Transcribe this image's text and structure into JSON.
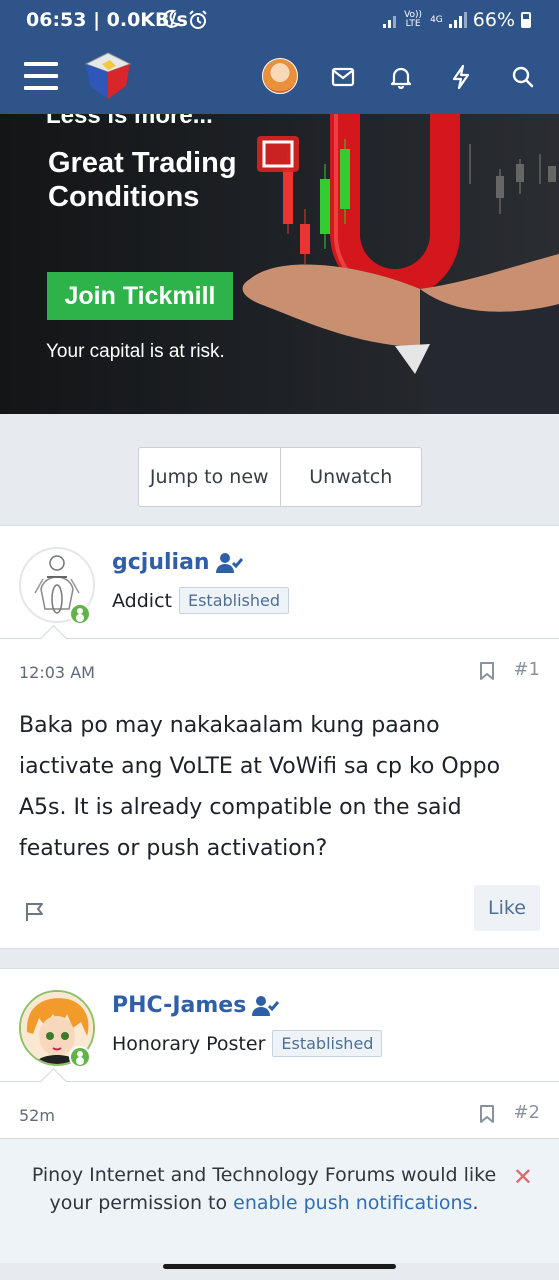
{
  "status_bar": {
    "time_speed": "06:53 | 0.0KB/s",
    "volte_label": "Vo)) LTE",
    "network_label": "4G",
    "battery": "66%"
  },
  "navbar": {
    "icons": [
      "menu-icon",
      "site-logo",
      "user-avatar",
      "mail-icon",
      "bell-icon",
      "lightning-icon",
      "search-icon"
    ]
  },
  "ad": {
    "tagline": "Less is more...",
    "headline": "Great Trading Conditions",
    "cta": "Join Tickmill",
    "disclaimer": "Your capital is at risk."
  },
  "thread_actions": {
    "jump_label": "Jump to new",
    "unwatch_label": "Unwatch"
  },
  "posts": [
    {
      "username": "gcjulian",
      "role": "Addict",
      "badge": "Established",
      "time": "12:03 AM",
      "number": "#1",
      "content": "Baka po may nakakaalam kung paano iactivate ang VoLTE at VoWifi sa cp ko Oppo A5s. It is already compatible on the said features or push activation?",
      "like_label": "Like"
    },
    {
      "username": "PHC-James",
      "role": "Honorary Poster",
      "badge": "Established",
      "time": "52m",
      "number": "#2"
    }
  ],
  "push_banner": {
    "text_before": "Pinoy Internet and Technology Forums would like your permission to ",
    "link": "enable push notifications",
    "text_after": ".",
    "close": "✕"
  },
  "colors": {
    "header": "#2f5489",
    "link": "#2f5fa6",
    "online": "#63b34b",
    "ad_button": "#2db34a"
  }
}
